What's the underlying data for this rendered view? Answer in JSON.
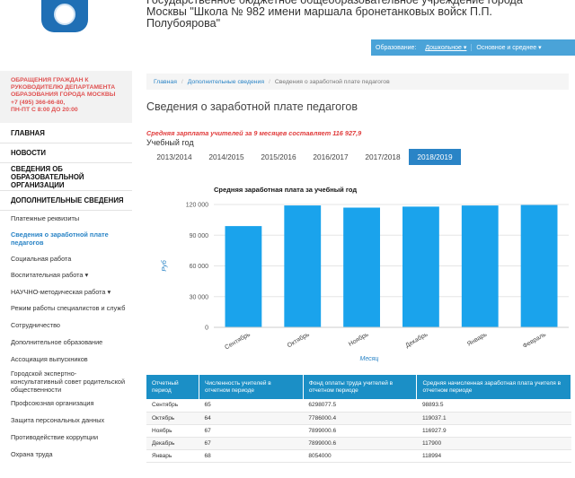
{
  "header": {
    "org_name": "Государственное бюджетное общеобразовательное учреждение города Москвы \"Школа № 982 имени маршала бронетанковых войск П.П. Полубоярова\"",
    "nav": [
      "Образование:",
      "Дошкольное ▾",
      "Основное и среднее ▾"
    ]
  },
  "sidebar": {
    "appeal": {
      "line1": "ОБРАЩЕНИЯ ГРАЖДАН К",
      "line2": "РУКОВОДИТЕЛЮ ДЕПАРТАМЕНТА",
      "line3": "ОБРАЗОВАНИЯ ГОРОДА МОСКВЫ",
      "phone": "+7 (495) 366-66-80,",
      "hours": "ПН-ПТ С 8:00 ДО 20:00"
    },
    "items": [
      {
        "label": "ГЛАВНАЯ",
        "bold": true
      },
      {
        "label": "НОВОСТИ",
        "bold": true
      },
      {
        "label": "СВЕДЕНИЯ ОБ ОБРАЗОВАТЕЛЬНОЙ ОРГАНИЗАЦИИ",
        "bold": true
      },
      {
        "label": "ДОПОЛНИТЕЛЬНЫЕ СВЕДЕНИЯ",
        "bold": true
      },
      {
        "label": "Платежные реквизиты"
      },
      {
        "label": "Сведения о заработной плате педагогов",
        "active": true
      },
      {
        "label": "Социальная работа"
      },
      {
        "label": "Воспитательная работа ▾"
      },
      {
        "label": "НАУЧНО-методическая работа ▾"
      },
      {
        "label": "Режим работы специалистов и служб"
      },
      {
        "label": "Сотрудничество"
      },
      {
        "label": "Дополнительное образование"
      },
      {
        "label": "Ассоциация выпускников"
      },
      {
        "label": "Городской экспертно-консультативный совет родительской общественности"
      },
      {
        "label": "Профсоюзная организация"
      },
      {
        "label": "Защита персональных данных"
      },
      {
        "label": "Противодействие коррупции"
      },
      {
        "label": "Охрана труда"
      }
    ]
  },
  "breadcrumb": [
    "Главная",
    "Дополнительные сведения",
    "Сведения о заработной плате педагогов"
  ],
  "page_title": "Сведения о заработной плате педагогов",
  "salary_note": "Средняя зарплата учителей за 9 месяцев составляет 116 927,9",
  "year_label": "Учебный год",
  "year_tabs": [
    "2013/2014",
    "2014/2015",
    "2015/2016",
    "2016/2017",
    "2017/2018",
    "2018/2019"
  ],
  "active_tab": 5,
  "chart_data": {
    "type": "bar",
    "title": "Средняя заработная плата за учебный год",
    "xlabel": "Месяц",
    "ylabel": "Руб",
    "categories": [
      "Сентябрь",
      "Октябрь",
      "Ноябрь",
      "Декабрь",
      "Январь",
      "Февраль"
    ],
    "values": [
      98893.5,
      119037.1,
      116927.9,
      117900,
      118994,
      119500
    ],
    "ylim": [
      0,
      120000
    ],
    "yticks": [
      "0",
      "30 000",
      "60 000",
      "90 000",
      "120 000"
    ],
    "grid": true,
    "bar_color": "#1aa3ec"
  },
  "table": {
    "headers": [
      "Отчетный период",
      "Численность учителей в отчетном периоде",
      "Фонд оплаты труда учителей в отчетном периоде",
      "Средняя начисленная заработная плата учителя в отчетном периоде"
    ],
    "rows": [
      [
        "Сентябрь",
        "65",
        "6298077.5",
        "98893.5"
      ],
      [
        "Октябрь",
        "64",
        "7786000.4",
        "119037.1"
      ],
      [
        "Ноябрь",
        "67",
        "7899000.6",
        "116927.9"
      ],
      [
        "Декабрь",
        "67",
        "7899000.6",
        "117900"
      ],
      [
        "Январь",
        "68",
        "8054000",
        "118994"
      ]
    ]
  }
}
